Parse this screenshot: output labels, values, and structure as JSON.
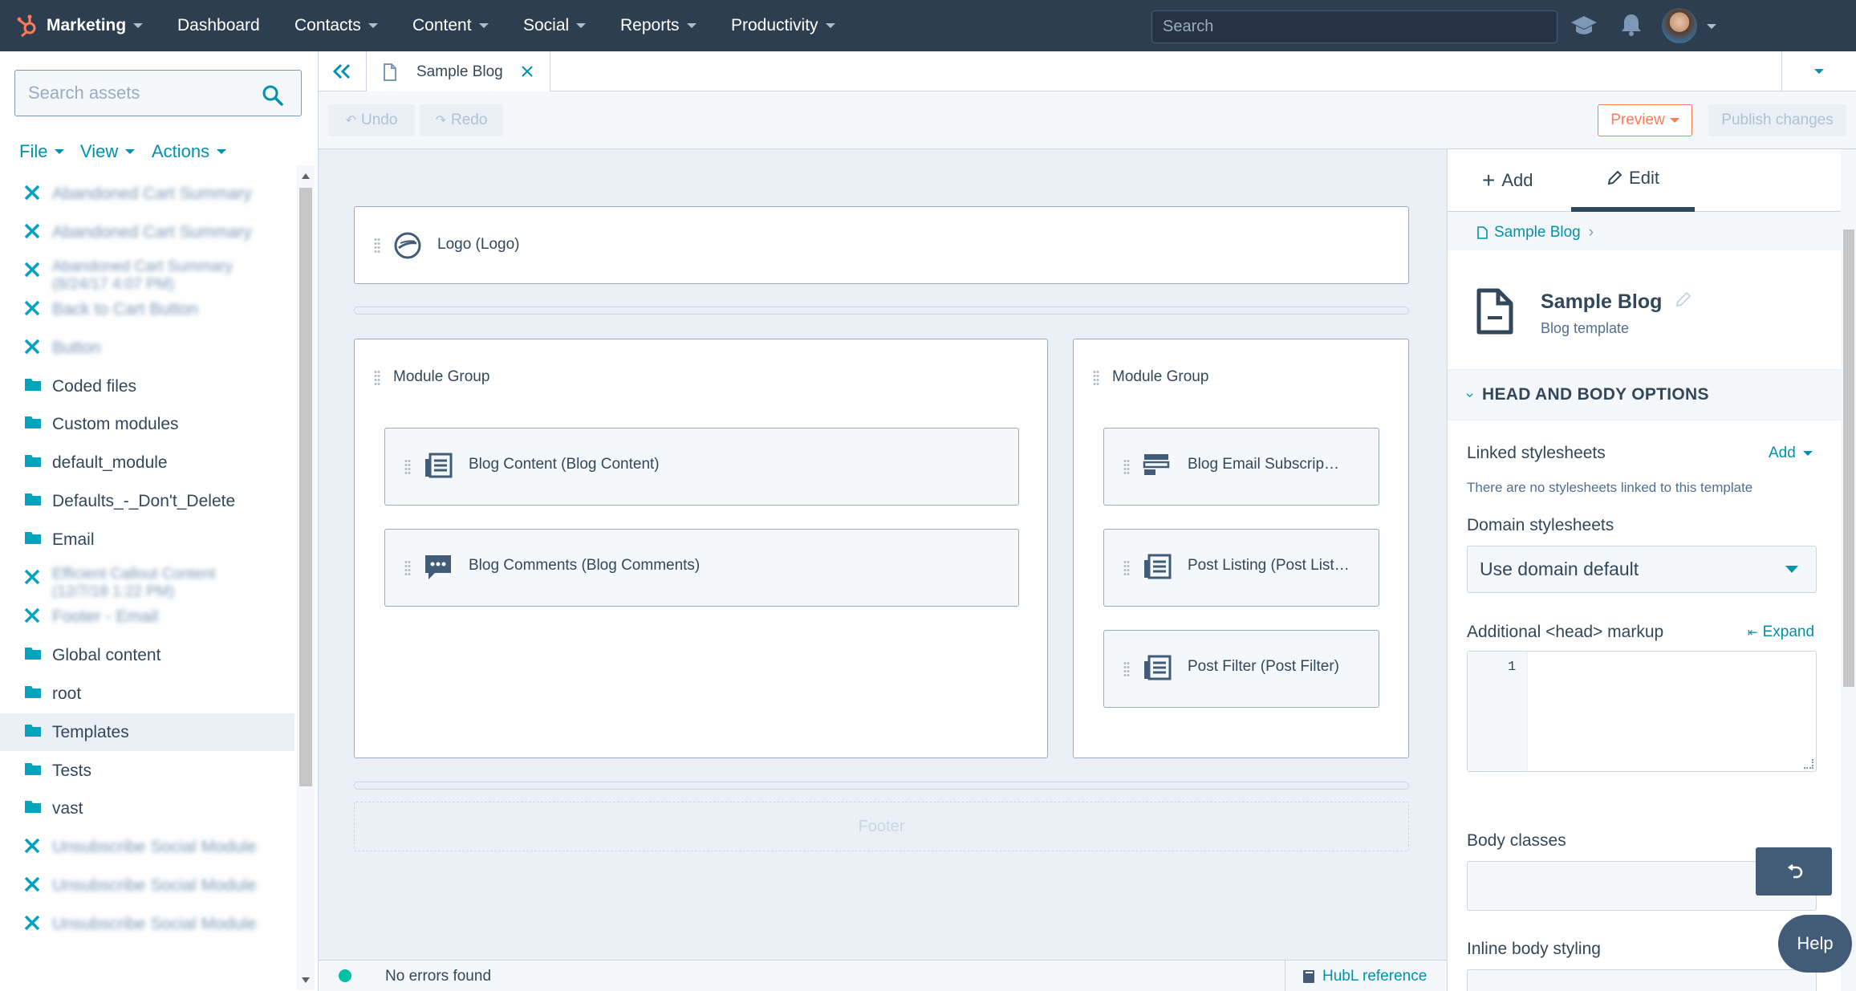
{
  "nav": {
    "app_name": "Marketing",
    "items": [
      "Dashboard",
      "Contacts",
      "Content",
      "Social",
      "Reports",
      "Productivity"
    ],
    "search_placeholder": "Search"
  },
  "left": {
    "search_placeholder": "Search assets",
    "menus": [
      "File",
      "View",
      "Actions"
    ],
    "tree": [
      {
        "type": "module",
        "label": "Abandoned Cart Summary",
        "blurred": true
      },
      {
        "type": "module",
        "label": "Abandoned Cart Summary",
        "blurred": true
      },
      {
        "type": "module",
        "label": "Abandoned Cart Summary (8/24/17 4:07 PM)",
        "blurred": true
      },
      {
        "type": "module",
        "label": "Back to Cart Button",
        "blurred": true
      },
      {
        "type": "module",
        "label": "Button",
        "blurred": true
      },
      {
        "type": "folder",
        "label": "Coded files",
        "blurred": false
      },
      {
        "type": "folder",
        "label": "Custom modules",
        "blurred": false
      },
      {
        "type": "folder",
        "label": "default_module",
        "blurred": false
      },
      {
        "type": "folder",
        "label": "Defaults_-_Don't_Delete",
        "blurred": false
      },
      {
        "type": "folder",
        "label": "Email",
        "blurred": false
      },
      {
        "type": "module",
        "label": "Efficient Callout Content (12/7/18 1:22 PM)",
        "blurred": true
      },
      {
        "type": "module",
        "label": "Footer - Email",
        "blurred": true
      },
      {
        "type": "folder",
        "label": "Global content",
        "blurred": false
      },
      {
        "type": "folder",
        "label": "root",
        "blurred": false
      },
      {
        "type": "folder",
        "label": "Templates",
        "blurred": false,
        "selected": true
      },
      {
        "type": "folder",
        "label": "Tests",
        "blurred": false
      },
      {
        "type": "folder",
        "label": "vast",
        "blurred": false
      },
      {
        "type": "module",
        "label": "Unsubscribe Social Module",
        "blurred": true
      },
      {
        "type": "module",
        "label": "Unsubscribe Social Module",
        "blurred": true
      },
      {
        "type": "module",
        "label": "Unsubscribe Social Module",
        "blurred": true
      }
    ]
  },
  "tab": {
    "title": "Sample Blog"
  },
  "toolbar": {
    "undo": "Undo",
    "redo": "Redo",
    "preview": "Preview",
    "publish": "Publish changes"
  },
  "canvas": {
    "logo": "Logo (Logo)",
    "group1": "Module Group",
    "group2": "Module Group",
    "modules_left": [
      "Blog Content (Blog Content)",
      "Blog Comments (Blog Comments)"
    ],
    "modules_right": [
      "Blog Email Subscrip…",
      "Post Listing (Post List…",
      "Post Filter (Post Filter)"
    ],
    "footer": "Footer"
  },
  "status": {
    "message": "No errors found",
    "hubl_link": "HubL reference"
  },
  "right": {
    "tab_add": "Add",
    "tab_edit": "Edit",
    "breadcrumb": "Sample Blog",
    "template_name": "Sample Blog",
    "template_type": "Blog template",
    "section_title": "HEAD AND BODY OPTIONS",
    "linked_stylesheets": "Linked stylesheets",
    "linked_add": "Add",
    "no_stylesheets": "There are no stylesheets linked to this template",
    "domain_stylesheets": "Domain stylesheets",
    "domain_select_value": "Use domain default",
    "head_markup": "Additional <head> markup",
    "expand": "Expand",
    "line_number": "1",
    "body_classes": "Body classes",
    "inline_body": "Inline body styling",
    "help": "Help"
  }
}
